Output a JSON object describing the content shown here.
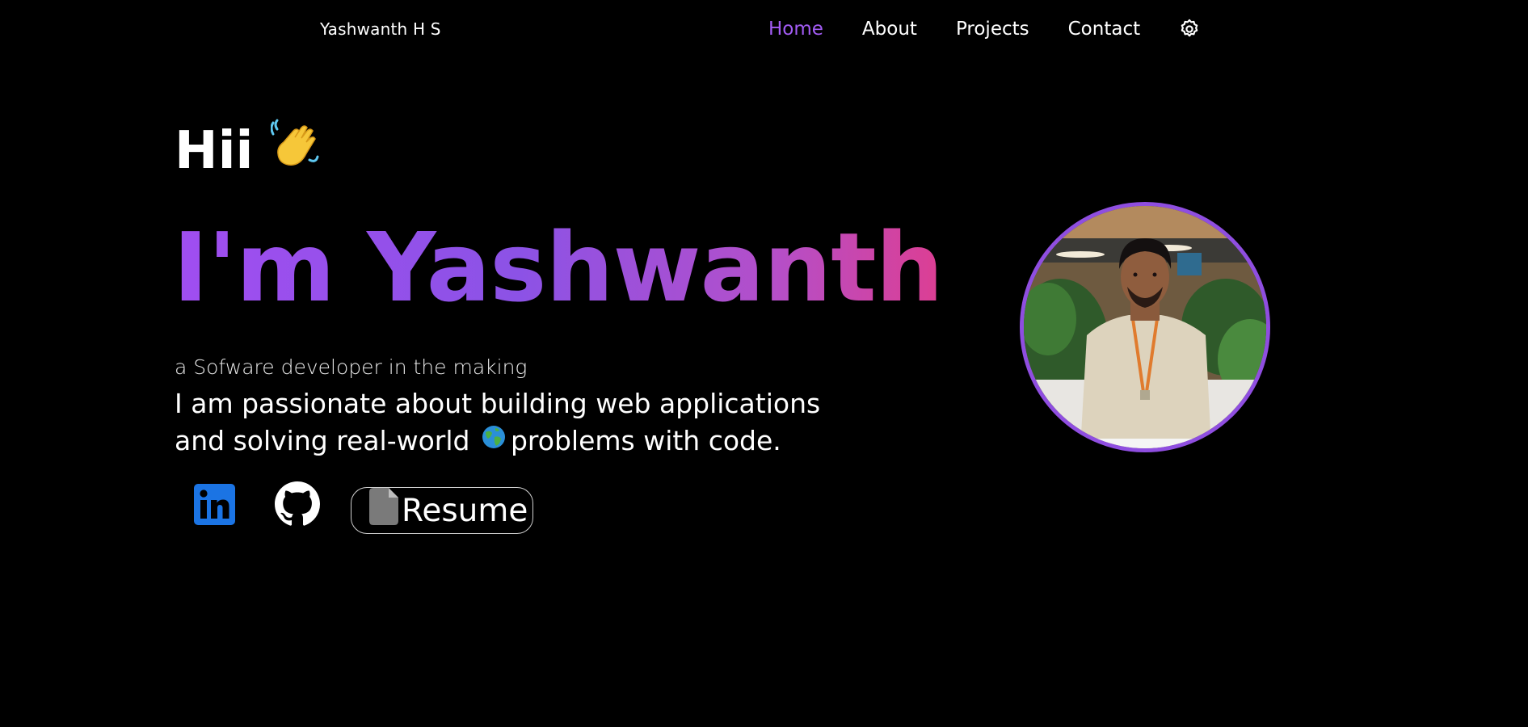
{
  "header": {
    "brand": "Yashwanth H S",
    "nav": [
      {
        "label": "Home",
        "active": true
      },
      {
        "label": "About",
        "active": false
      },
      {
        "label": "Projects",
        "active": false
      },
      {
        "label": "Contact",
        "active": false
      }
    ],
    "theme_icon": "gear-icon"
  },
  "hero": {
    "greeting": "Hii",
    "greeting_emoji": "waving-hand-icon",
    "headline": "I'm Yashwanth",
    "tagline": "a Sofware developer in the making",
    "bio_part1": "I am passionate about building web applications and solving real-world",
    "bio_emoji": "globe-icon",
    "bio_part2": "problems with code."
  },
  "socials": {
    "linkedin_icon": "linkedin-icon",
    "github_icon": "github-icon",
    "resume_label": "Resume",
    "resume_icon": "document-icon"
  },
  "avatar": {
    "icon": "profile-photo"
  },
  "colors": {
    "background": "#000000",
    "accent": "#a35cf5",
    "gradient_start": "#a04ef0",
    "gradient_end": "#dd3e92",
    "avatar_border": "#8f4ee0",
    "linkedin_blue": "#1b74e4"
  }
}
